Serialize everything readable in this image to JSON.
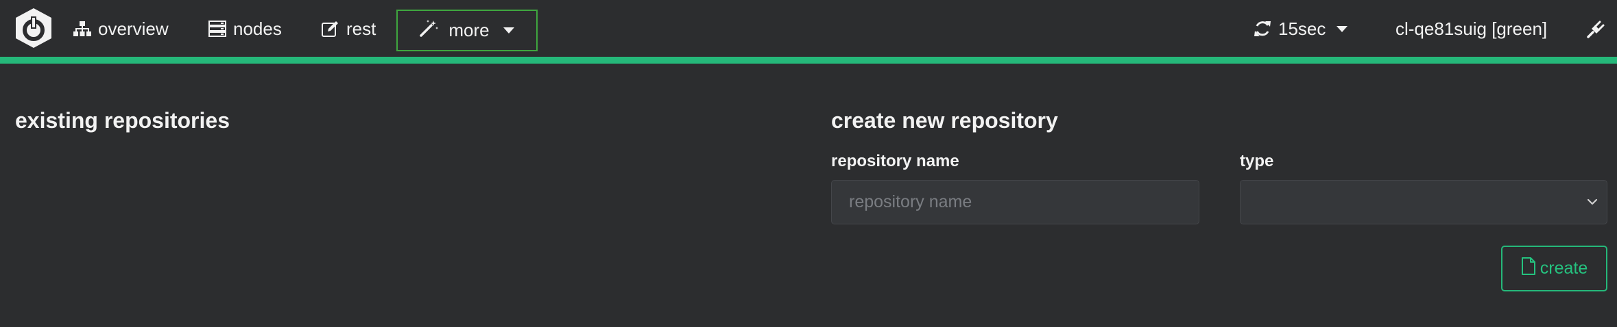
{
  "nav": {
    "overview_label": "overview",
    "nodes_label": "nodes",
    "rest_label": "rest",
    "more_label": "more",
    "refresh_label": "15sec",
    "cluster_label": "cl-qe81suig [green]"
  },
  "content": {
    "existing_title": "existing repositories",
    "create_title": "create new repository",
    "name_label": "repository name",
    "name_placeholder": "repository name",
    "name_value": "",
    "type_label": "type",
    "type_value": "",
    "create_button": "create"
  },
  "icons": {
    "logo": "cerebro-logo-icon",
    "overview": "sitemap-icon",
    "nodes": "server-icon",
    "rest": "edit-icon",
    "more": "magic-wand-icon",
    "refresh": "refresh-icon",
    "connection": "plug-icon",
    "create": "file-icon",
    "select": "chevron-down-icon"
  },
  "colors": {
    "background": "#2c2d2f",
    "accent": "#25b87a",
    "more_border": "#3fa63f",
    "input_background": "#35373a"
  }
}
